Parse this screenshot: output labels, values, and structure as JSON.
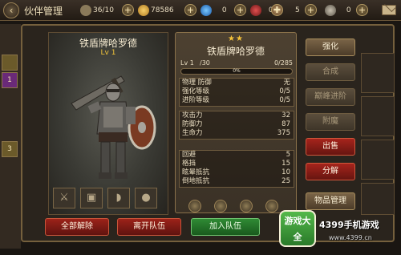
{
  "header": {
    "title": "伙伴管理",
    "partner_count": "36/10",
    "gold": "78586",
    "gems": "0",
    "honor": "0",
    "tokens": "5",
    "keys": "0"
  },
  "left_strip": {
    "items": [
      "",
      "1",
      "3"
    ]
  },
  "hero": {
    "name": "铁盾牌哈罗德",
    "level": "Lv 1",
    "equip_slots": [
      "sword-icon",
      "armor-icon",
      "boots-icon",
      "helmet-icon"
    ]
  },
  "stats": {
    "stars": "★★",
    "name": "铁盾牌哈罗德",
    "level_label": "Lv 1",
    "level_max": "/30",
    "xp": "0/285",
    "xp_pct": "0%",
    "xp_fraction": 0,
    "group1": [
      {
        "k": "物理 防御",
        "v": "无"
      },
      {
        "k": "强化等级",
        "v": "0/5"
      },
      {
        "k": "进阶等级",
        "v": "0/5"
      }
    ],
    "group2": [
      {
        "k": "攻击力",
        "v": "32"
      },
      {
        "k": "防御力",
        "v": "87"
      },
      {
        "k": "生命力",
        "v": "375"
      }
    ],
    "group3": [
      {
        "k": "回避",
        "v": "5"
      },
      {
        "k": "格挡",
        "v": "15"
      },
      {
        "k": "眩晕抵抗",
        "v": "10"
      },
      {
        "k": "倒地抵抗",
        "v": "25"
      }
    ]
  },
  "actions": {
    "strengthen": "强化",
    "combine": "合成",
    "advance": "巅峰进阶",
    "enchant": "附魔",
    "sell": "出售",
    "decompose": "分解",
    "item_manage": "物品管理"
  },
  "bottom": {
    "release_all": "全部解除",
    "leave_team": "离开队伍",
    "join_team": "加入队伍"
  },
  "watermark": {
    "badge": "游戏大全",
    "brand": "4399手机游戏",
    "url": "www.4399.cn"
  },
  "colors": {
    "accent_gold": "#c9a648",
    "red_button": "#9c2219",
    "green_button": "#2f8a34"
  }
}
